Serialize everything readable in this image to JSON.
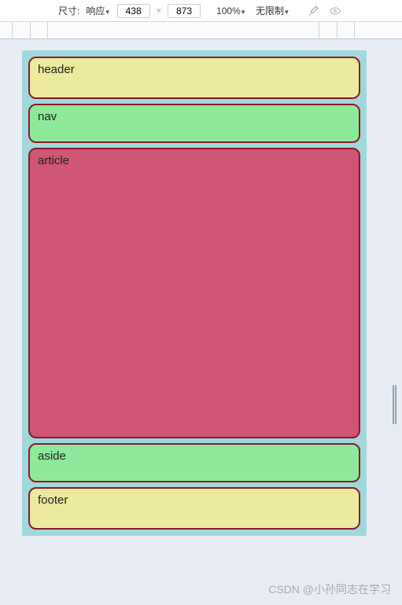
{
  "toolbar": {
    "size_label": "尺寸:",
    "responsive_label": "响应",
    "width": "438",
    "height": "873",
    "zoom": "100%",
    "throttle": "无限制"
  },
  "layout": {
    "header": "header",
    "nav": "nav",
    "article": "article",
    "aside": "aside",
    "footer": "footer"
  },
  "watermark": "CSDN @小孙同志在学习"
}
